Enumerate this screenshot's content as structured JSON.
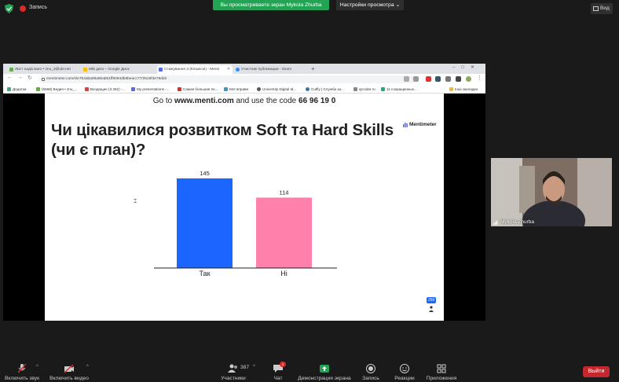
{
  "zoom": {
    "recording_label": "Запись",
    "share_banner": "Вы просматриваете экран Mykola Zhurba",
    "view_settings": "Настройки просмотра",
    "view_button": "Вид",
    "participant_name": "Mykola Zhurba",
    "toolbar": {
      "audio": "Включить звук",
      "video": "Включить видео",
      "participants": "Участники",
      "participant_count": "387",
      "chat": "Чат",
      "chat_badge": "1",
      "share": "Демонстрация экрана",
      "record": "Запись",
      "reactions": "Реакции",
      "apps": "Приложения",
      "leave": "Выйти"
    },
    "colors": {
      "share_green": "#23a455",
      "leave_red": "#c4282e"
    }
  },
  "browser": {
    "tabs": [
      {
        "label": "Лист надіслано • znu_3@ukr.net",
        "active": false
      },
      {
        "label": "Мій диск – Google Диск",
        "active": false
      },
      {
        "label": "Стажування 3 (Кількісні) - Menti",
        "active": true
      },
      {
        "label": "Участник публикации - Zoom",
        "active": false
      }
    ],
    "url": "mentimeter.com/s/e764aba08a5bab51ff6094db6beacc77/2519f3e79dd2",
    "bookmarks": [
      "Додатки",
      "(5568) Ведия • znu_...",
      "Входящие (3 362) -...",
      "My presentations -...",
      "Самая большая по...",
      "Мої вправи",
      "University Digital Id...",
      "Cutfly | Служба за...",
      "qrcoder.ru",
      "11 сокращенных...",
      "Інші закладки"
    ]
  },
  "slide": {
    "join_prefix": "Go to ",
    "join_site": "www.menti.com",
    "join_middle": " and use the code ",
    "join_code": "66 96 19 0",
    "title": "Чи цікавилися розвитком Soft та Hard Skills (чи є план)?",
    "logo": "Mentimeter",
    "responses": "259"
  },
  "chart_data": {
    "type": "bar",
    "title": "Чи цікавилися розвитком Soft та Hard Skills (чи є план)?",
    "categories": [
      "Так",
      "Ні"
    ],
    "values": [
      145,
      114
    ],
    "colors": [
      "#1b66ff",
      "#ff80ab"
    ],
    "data_labels": [
      "145",
      "114"
    ],
    "xlabel": "",
    "ylabel": "",
    "grid": false
  }
}
